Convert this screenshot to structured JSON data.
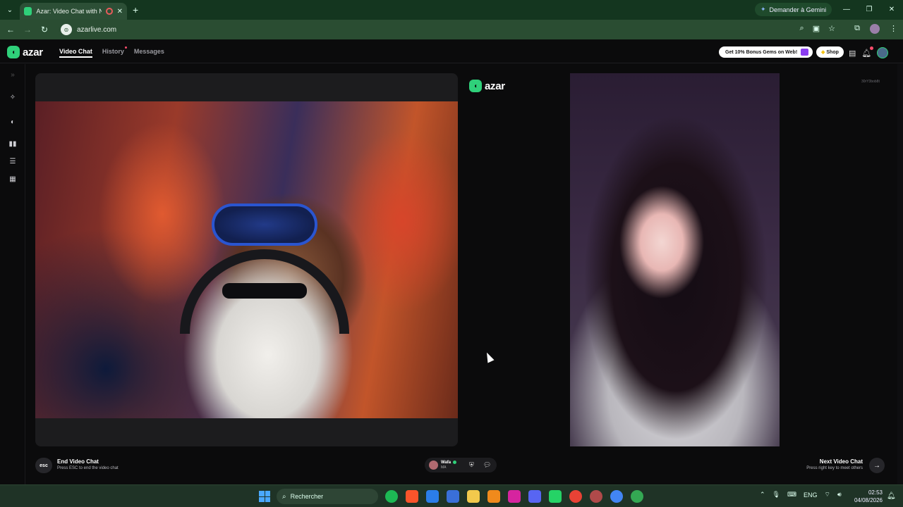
{
  "browser": {
    "tab_title": "Azar: Video Chat with New",
    "url": "azarlive.com",
    "gemini_label": "Demander à Gemini"
  },
  "app": {
    "logo_text": "azar",
    "nav": [
      {
        "label": "Video Chat",
        "active": true
      },
      {
        "label": "History",
        "active": false
      },
      {
        "label": "Messages",
        "active": false
      }
    ],
    "promo_label": "Get 10% Bonus Gems on Web!",
    "shop_label": "Shop"
  },
  "call": {
    "center_logo": "azar",
    "peer_name": "Wafa",
    "peer_country": "MA",
    "end_title": "End Video Chat",
    "end_sub": "Press ESC to end the video chat",
    "esc_label": "esc",
    "next_title": "Next Video Chat",
    "next_sub": "Press right key to meet others",
    "watermark": "30rY3bob8t"
  },
  "taskbar": {
    "search_placeholder": "Rechercher",
    "lang": "ENG",
    "time": "02:53",
    "date": "04/08/2026"
  },
  "colors": {
    "accent": "#2fd07a",
    "chrome_bg": "#14361f",
    "app_bg": "#0b0b0c"
  }
}
